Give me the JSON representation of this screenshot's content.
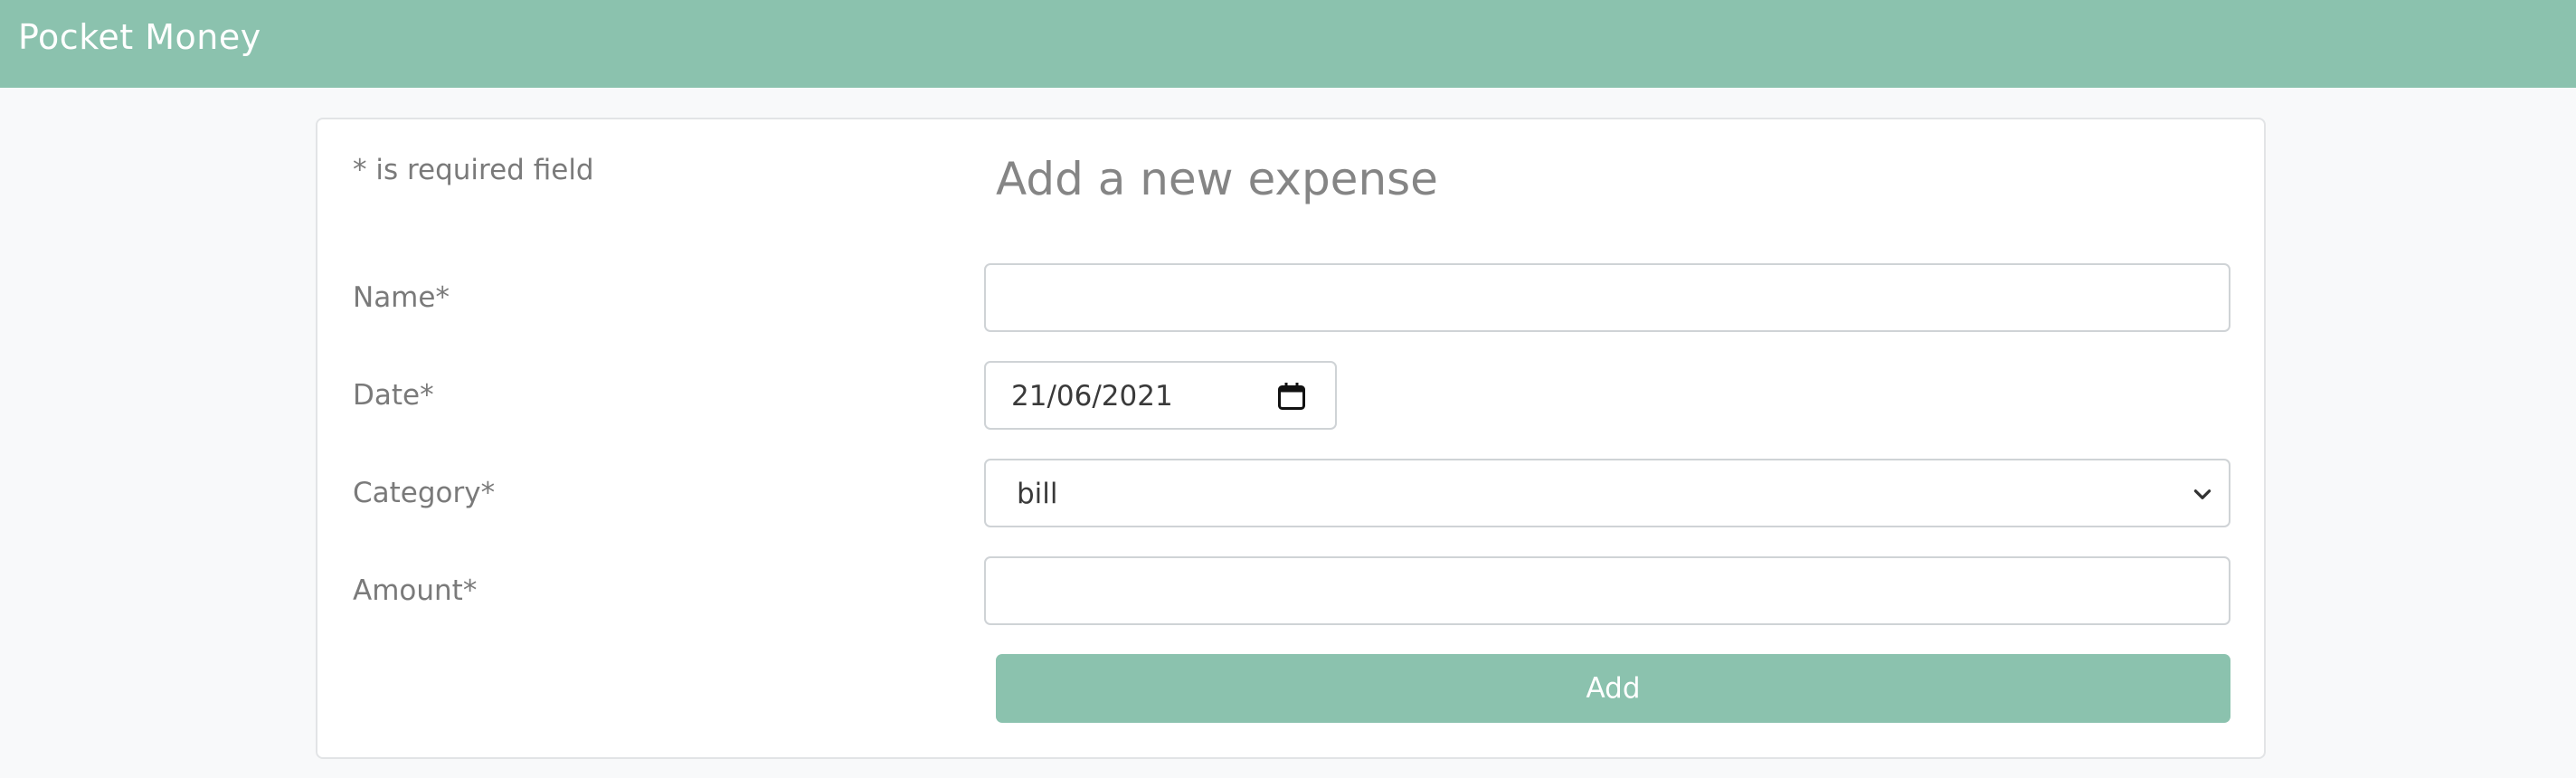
{
  "header": {
    "app_title": "Pocket Money"
  },
  "form": {
    "required_note": "* is required field",
    "title": "Add a new expense",
    "name": {
      "label": "Name*",
      "value": ""
    },
    "date": {
      "label": "Date*",
      "value": "21/06/2021"
    },
    "category": {
      "label": "Category*",
      "value": "bill"
    },
    "amount": {
      "label": "Amount*",
      "value": ""
    },
    "submit_label": "Add"
  },
  "theme": {
    "accent": "#8bc2ae",
    "background": "#f8f9fa",
    "text_muted": "#7a7a7a"
  },
  "icons": {
    "date_picker": "calendar-icon",
    "category_select": "chevron-down-icon"
  }
}
